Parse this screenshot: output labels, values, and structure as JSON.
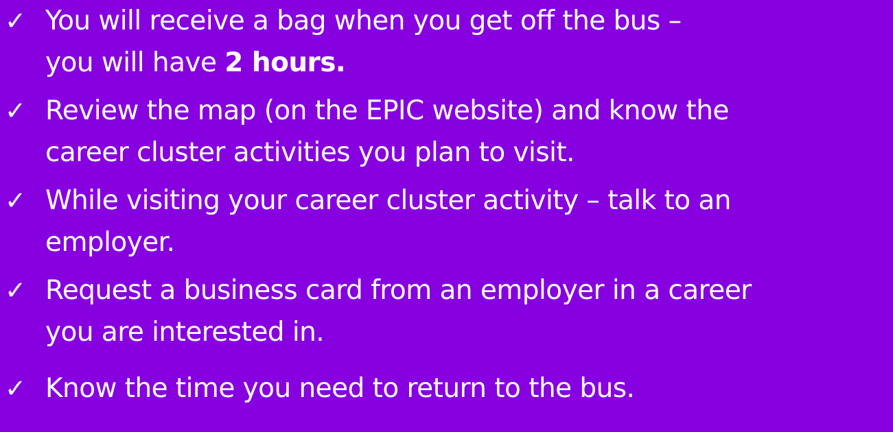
{
  "slide": {
    "background_color": "#8600e0",
    "text_color": "#ffffff",
    "check_icon": "check-mark-icon",
    "items": [
      {
        "lines": [
          "You will receive a bag when you get off the bus –",
          "you will have "
        ],
        "bold": "2 hours."
      },
      {
        "lines": [
          "Review the map (on the EPIC website) and know the",
          "career cluster activities you plan to visit."
        ]
      },
      {
        "lines": [
          "While visiting your career cluster activity – talk to an",
          "employer."
        ]
      },
      {
        "lines": [
          "Request a business card from an employer in a career",
          "you are interested in."
        ]
      },
      {
        "lines": [
          "Know the time you need to return to the bus."
        ]
      }
    ]
  }
}
